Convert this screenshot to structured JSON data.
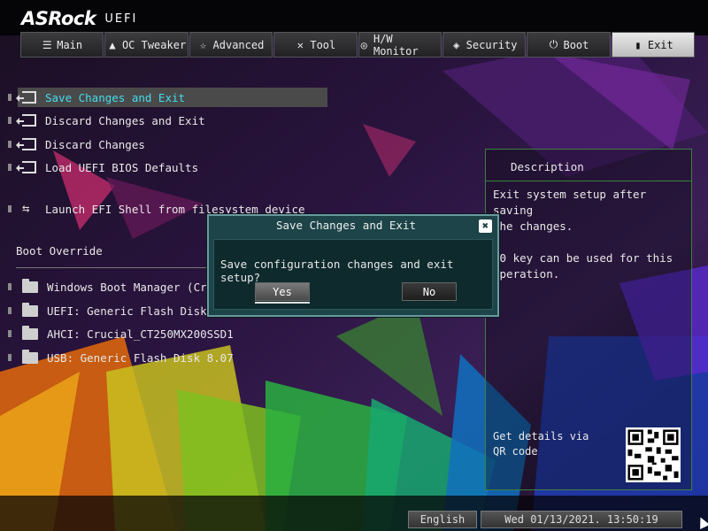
{
  "brand": {
    "name": "ASRock",
    "product": "UEFI"
  },
  "tabs": [
    {
      "label": "Main",
      "icon": "list-icon",
      "active": false
    },
    {
      "label": "OC Tweaker",
      "icon": "rocket-icon",
      "active": false
    },
    {
      "label": "Advanced",
      "icon": "star-icon",
      "active": false
    },
    {
      "label": "Tool",
      "icon": "tools-icon",
      "active": false
    },
    {
      "label": "H/W Monitor",
      "icon": "monitor-icon",
      "active": false
    },
    {
      "label": "Security",
      "icon": "shield-icon",
      "active": false
    },
    {
      "label": "Boot",
      "icon": "power-icon",
      "active": false
    },
    {
      "label": "Exit",
      "icon": "exit-icon",
      "active": true
    }
  ],
  "menu": {
    "items": [
      {
        "label": "Save Changes and Exit",
        "selected": true
      },
      {
        "label": "Discard Changes and Exit",
        "selected": false
      },
      {
        "label": "Discard Changes",
        "selected": false
      },
      {
        "label": "Load UEFI BIOS Defaults",
        "selected": false
      },
      {
        "label": "Launch EFI Shell from filesystem device",
        "selected": false
      }
    ],
    "boot_override_title": "Boot Override",
    "boot_items": [
      "Windows Boot Manager (Crucial_",
      "UEFI: Generic Flash Disk 8.07",
      "AHCI:  Crucial_CT250MX200SSD1",
      "USB: Generic Flash Disk 8.07"
    ]
  },
  "description": {
    "title": "Description",
    "text": "Exit system setup after saving\nthe changes.\n\n10 key can be used for this\noperation.",
    "qr_label": "Get details via QR code"
  },
  "dialog": {
    "title": "Save Changes and Exit",
    "message": "Save configuration changes and exit setup?",
    "yes_label": "Yes",
    "no_label": "No",
    "close_glyph": "✖"
  },
  "status": {
    "language": "English",
    "datetime": "Wed 01/13/2021. 13:50:19"
  }
}
